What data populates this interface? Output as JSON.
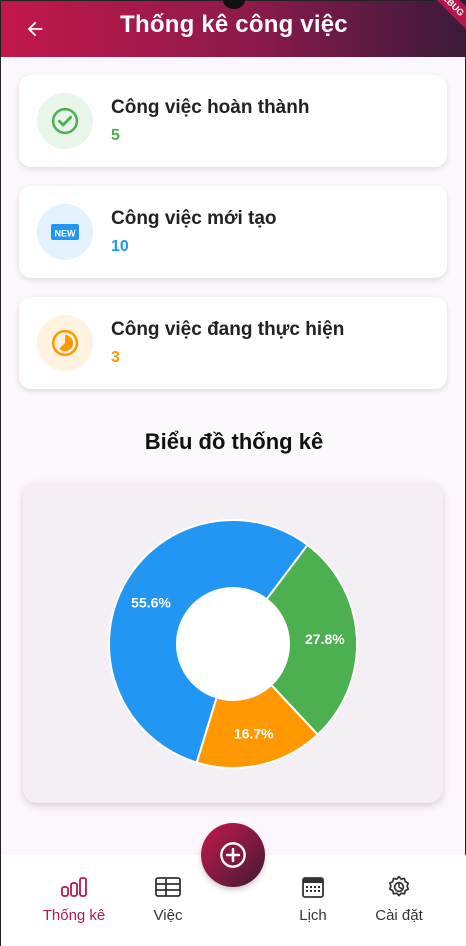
{
  "header": {
    "title": "Thống kê công việc",
    "back_icon": "arrow-left-icon",
    "debug_badge": "DEBUG"
  },
  "stats": [
    {
      "label": "Công việc hoàn thành",
      "value": "5",
      "icon": "check-circle-icon",
      "color": "#4caf50",
      "bg": "#e8f5e9"
    },
    {
      "label": "Công việc mới tạo",
      "value": "10",
      "icon": "new-badge-icon",
      "color": "#2196f3",
      "bg": "#e3f2fd"
    },
    {
      "label": "Công việc đang thực hiện",
      "value": "3",
      "icon": "timelapse-icon",
      "color": "#ff9800",
      "bg": "#fff3e0"
    }
  ],
  "chart_heading": "Biểu đồ thống kê",
  "chart_data": {
    "type": "pie",
    "donut": true,
    "categories": [
      "Công việc mới tạo",
      "Công việc hoàn thành",
      "Công việc đang thực hiện"
    ],
    "values": [
      55.6,
      27.8,
      16.7
    ],
    "labels": [
      "55.6%",
      "27.8%",
      "16.7%"
    ],
    "colors": [
      "#2196f3",
      "#4caf50",
      "#ff9800"
    ]
  },
  "fab": {
    "icon": "add-circle-icon"
  },
  "nav": {
    "items": [
      {
        "label": "Thống kê",
        "icon": "bar-chart-icon",
        "active": true
      },
      {
        "label": "Việc",
        "icon": "table-icon",
        "active": false
      },
      {
        "label": "Lịch",
        "icon": "calendar-icon",
        "active": false
      },
      {
        "label": "Cài đặt",
        "icon": "settings-icon",
        "active": false
      }
    ]
  }
}
